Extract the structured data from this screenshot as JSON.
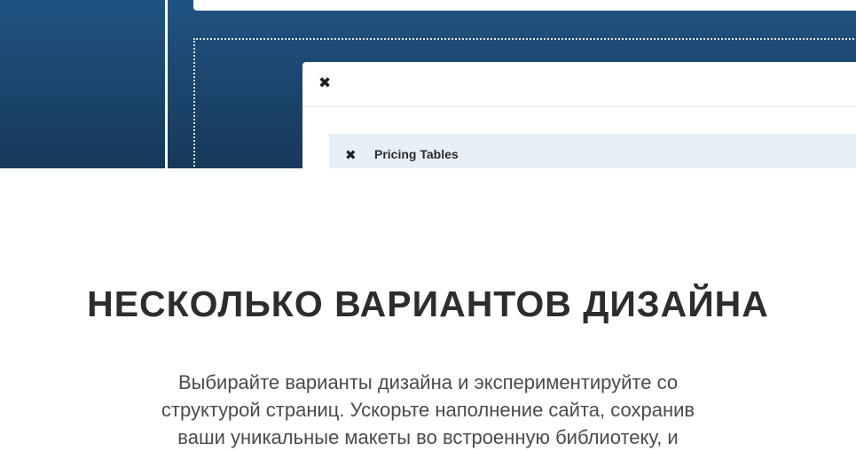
{
  "hero": {
    "modal": {
      "close_icon": "✖",
      "row": {
        "remove_icon": "✖",
        "title": "Pricing Tables"
      }
    },
    "colors": {
      "gradient_top": "#205381",
      "gradient_bottom": "#17395a",
      "row_background": "#e8f0f7"
    }
  },
  "section": {
    "heading": "НЕСКОЛЬКО ВАРИАНТОВ ДИЗАЙНА",
    "description": "Выбирайте варианты дизайна и экспериментируйте со структурой страниц. Ускорьте наполнение сайта, сохранив ваши уникальные макеты во встроенную библиотеку, и"
  }
}
